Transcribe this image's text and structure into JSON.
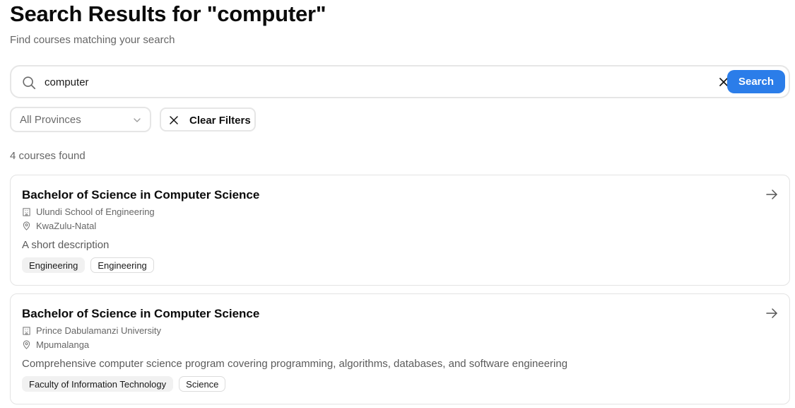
{
  "header": {
    "title": "Search Results for \"computer\"",
    "subtitle": "Find courses matching your search"
  },
  "search": {
    "value": "computer",
    "button_label": "Search"
  },
  "filters": {
    "province_selected": "All Provinces",
    "clear_label": "Clear Filters"
  },
  "results": {
    "count_text": "4 courses found",
    "courses": [
      {
        "title": "Bachelor of Science in Computer Science",
        "institution": "Ulundi School of Engineering",
        "province": "KwaZulu-Natal",
        "description": "A short description",
        "tags": [
          "Engineering",
          "Engineering"
        ]
      },
      {
        "title": "Bachelor of Science in Computer Science",
        "institution": "Prince Dabulamanzi University",
        "province": "Mpumalanga",
        "description": "Comprehensive computer science program covering programming, algorithms, databases, and software engineering",
        "tags": [
          "Faculty of Information Technology",
          "Science"
        ]
      }
    ]
  },
  "colors": {
    "accent": "#2b7de9",
    "border": "#e6e6e6",
    "muted_text": "#666666"
  },
  "icons": {
    "search": "search-icon",
    "clear": "close-icon",
    "select": "chevron-down-icon",
    "card_arrow": "arrow-right-icon",
    "institution": "building-icon",
    "location": "map-pin-icon"
  }
}
